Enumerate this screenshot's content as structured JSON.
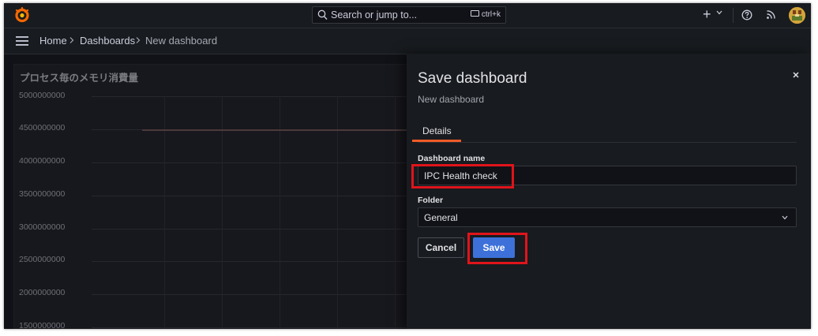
{
  "topbar": {
    "search_placeholder": "Search or jump to...",
    "search_shortcut": "ctrl+k",
    "plus_label": "+"
  },
  "breadcrumb": {
    "items": [
      "Home",
      "Dashboards",
      "New dashboard"
    ]
  },
  "panel": {
    "title": "プロセス毎のメモリ消費量",
    "y_ticks": [
      "5000000000",
      "4500000000",
      "4000000000",
      "3500000000",
      "3000000000",
      "2500000000",
      "2000000000",
      "1500000000"
    ]
  },
  "drawer": {
    "title": "Save dashboard",
    "subtitle": "New dashboard",
    "close_label": "×",
    "tabs": [
      {
        "label": "Details",
        "active": true
      }
    ],
    "dashboard_name_label": "Dashboard name",
    "dashboard_name_value": "IPC Health check",
    "folder_label": "Folder",
    "folder_value": "General",
    "cancel_label": "Cancel",
    "save_label": "Save"
  },
  "colors": {
    "accent_tab": "#f05a28",
    "primary_button": "#3d71d9",
    "highlight": "#e0141b"
  },
  "icons": [
    "grafana-logo-icon",
    "search-icon",
    "keyboard-icon",
    "chevron-down-icon",
    "help-icon",
    "rss-icon",
    "menu-icon",
    "breadcrumb-chevron-icon",
    "close-icon"
  ]
}
